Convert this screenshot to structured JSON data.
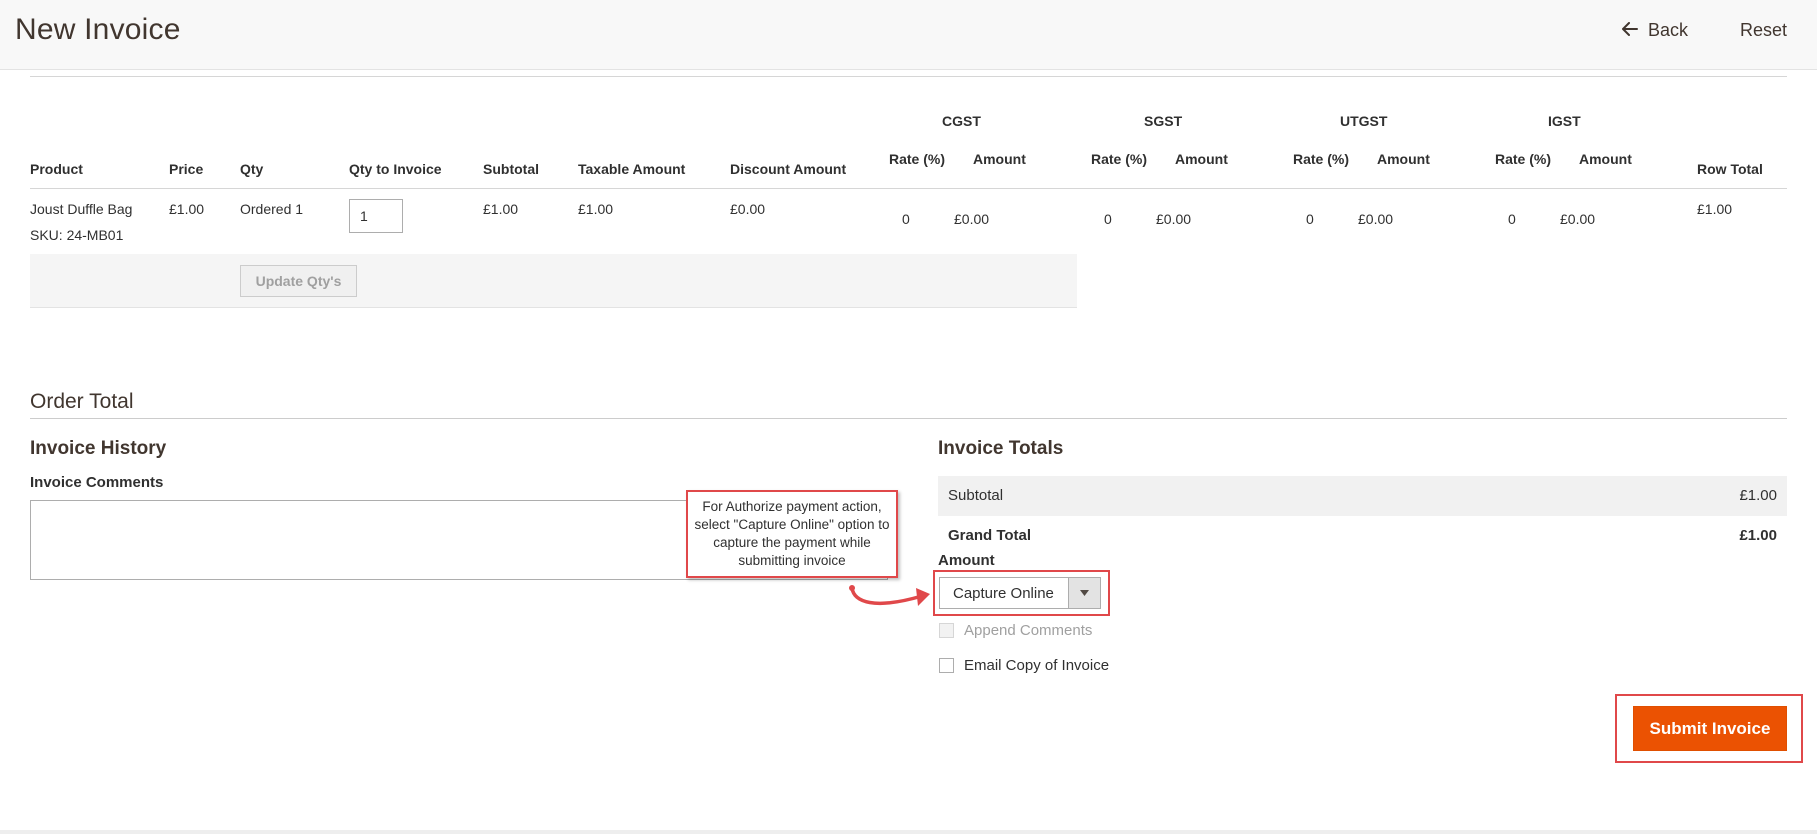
{
  "header": {
    "title": "New Invoice",
    "back_label": "Back",
    "reset_label": "Reset"
  },
  "items_table": {
    "headers": {
      "product": "Product",
      "price": "Price",
      "qty": "Qty",
      "qty_to_invoice": "Qty to Invoice",
      "subtotal": "Subtotal",
      "taxable_amount": "Taxable Amount",
      "discount_amount": "Discount Amount",
      "row_total": "Row Total"
    },
    "tax_groups": [
      {
        "name": "CGST",
        "rate_label": "Rate (%)",
        "amount_label": "Amount"
      },
      {
        "name": "SGST",
        "rate_label": "Rate (%)",
        "amount_label": "Amount"
      },
      {
        "name": "UTGST",
        "rate_label": "Rate (%)",
        "amount_label": "Amount"
      },
      {
        "name": "IGST",
        "rate_label": "Rate (%)",
        "amount_label": "Amount"
      }
    ],
    "rows": [
      {
        "product": "Joust Duffle Bag",
        "sku": "SKU: 24-MB01",
        "price": "£1.00",
        "qty": "Ordered 1",
        "qty_to_invoice": "1",
        "subtotal": "£1.00",
        "taxable_amount": "£1.00",
        "discount_amount": "£0.00",
        "taxes": [
          {
            "rate": "0",
            "amount": "£0.00"
          },
          {
            "rate": "0",
            "amount": "£0.00"
          },
          {
            "rate": "0",
            "amount": "£0.00"
          },
          {
            "rate": "0",
            "amount": "£0.00"
          }
        ],
        "row_total": "£1.00"
      }
    ],
    "update_button_label": "Update Qty's"
  },
  "order_total": {
    "title": "Order Total",
    "history": {
      "title": "Invoice History",
      "comments_label": "Invoice Comments",
      "comments_value": ""
    },
    "totals": {
      "title": "Invoice Totals",
      "subtotal_label": "Subtotal",
      "subtotal_value": "£1.00",
      "grand_total_label": "Grand Total",
      "grand_total_value": "£1.00",
      "amount_label": "Amount",
      "capture_selected": "Capture Online",
      "append_comments_label": "Append Comments",
      "email_copy_label": "Email Copy of Invoice",
      "submit_label": "Submit Invoice"
    }
  },
  "annotation": {
    "callout_text": "For Authorize payment action, select \"Capture Online\" option to capture the payment while submitting invoice",
    "color": "#e0484a"
  },
  "colors": {
    "accent": "#eb5202",
    "title_text": "#41362f"
  },
  "icons": {
    "back": "arrow-left-icon",
    "select": "chevron-down-icon"
  }
}
